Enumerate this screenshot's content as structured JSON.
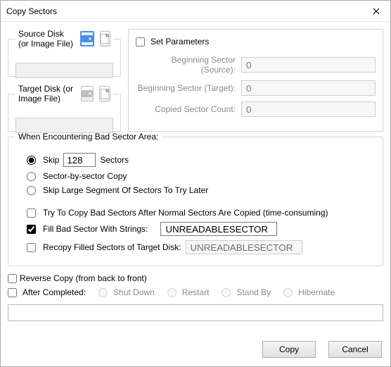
{
  "window": {
    "title": "Copy Sectors"
  },
  "source": {
    "label": "Source Disk (or Image File)"
  },
  "target": {
    "label": "Target Disk (or Image File)"
  },
  "params": {
    "set_label": "Set Parameters",
    "set_checked": false,
    "rows": [
      {
        "label": "Beginning Sector (Source):",
        "value": "0"
      },
      {
        "label": "Beginning Sector (Target):",
        "value": "0"
      },
      {
        "label": "Copied Sector Count:",
        "value": "0"
      }
    ]
  },
  "bad": {
    "legend": "When Encountering Bad Sector Area:",
    "skip_label_before": "Skip",
    "skip_value": "128",
    "skip_label_after": "Sectors",
    "skip_selected": true,
    "sector_by_sector": "Sector-by-sector Copy",
    "skip_large": "Skip Large Segment Of Sectors To Try Later",
    "try_copy": "Try To Copy Bad Sectors After Normal Sectors Are Copied (time-consuming)",
    "try_copy_checked": false,
    "fill_label": "Fill Bad Sector With Strings:",
    "fill_checked": true,
    "fill_value": "UNREADABLESECTOR",
    "recopy_label": "Recopy Filled Sectors of Target Disk:",
    "recopy_checked": false,
    "recopy_value": "UNREADABLESECTOR"
  },
  "reverse": {
    "label": "Reverse Copy (from back to front)",
    "checked": false
  },
  "after": {
    "label": "After Completed:",
    "checked": false,
    "options": [
      "Shut Down",
      "Restart",
      "Stand By",
      "Hibernate"
    ]
  },
  "buttons": {
    "copy": "Copy",
    "cancel": "Cancel"
  },
  "icons": {
    "disk": "disk-icon",
    "file": "file-icon",
    "close": "close-icon"
  }
}
